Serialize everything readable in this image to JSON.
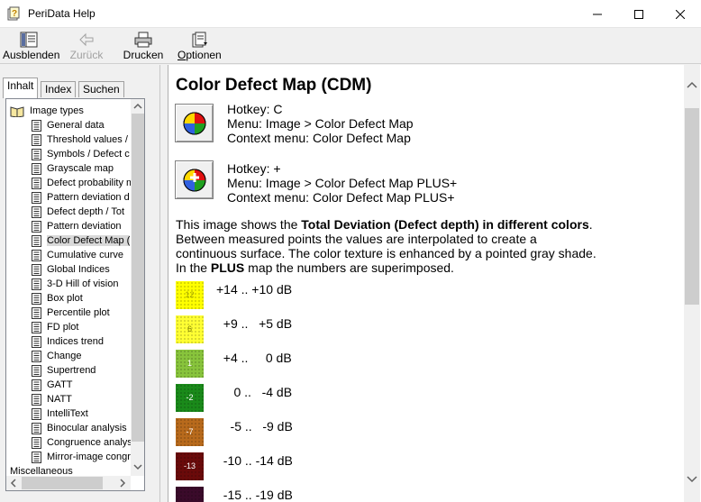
{
  "window": {
    "title": "PeriData Help"
  },
  "toolbar": {
    "hide": "Ausblenden",
    "back": "Zurück",
    "print": "Drucken",
    "options": "Optionen"
  },
  "tabs": [
    {
      "label": "Inhalt"
    },
    {
      "label": "Index"
    },
    {
      "label": "Suchen"
    }
  ],
  "tree": {
    "root": "Image types",
    "items": [
      "General data",
      "Threshold values / ",
      "Symbols / Defect c",
      "Grayscale map",
      "Defect probability m",
      "Pattern deviation d",
      "Defect depth / Tot",
      "Pattern deviation",
      "Color Defect Map (",
      "Cumulative curve",
      "Global Indices",
      "3-D Hill of vision",
      "Box plot",
      "Percentile plot",
      "FD plot",
      "Indices trend",
      "Change",
      "Supertrend",
      "GATT",
      "NATT",
      "IntelliText",
      "Binocular analysis",
      "Congruence analys",
      "Mirror-image congr"
    ],
    "selected_index": 8,
    "next_root": "Miscellaneous"
  },
  "content": {
    "title": "Color Defect Map (CDM)",
    "cdm": {
      "hotkey": "Hotkey: C",
      "menu": "Menu: Image > Color Defect Map",
      "context": "Context menu: Color Defect Map"
    },
    "cdm_plus": {
      "hotkey": "Hotkey: +",
      "menu": "Menu: Image > Color Defect Map PLUS+",
      "context": "Context menu: Color Defect Map PLUS+"
    },
    "desc": {
      "p1": "This image shows the ",
      "b1": "Total Deviation (Defect depth) in different colors",
      "p2": ". Between measured points the values are interpolated to create a continuous surface. The color texture is enhanced by a pointed gray shade. In the ",
      "b2": "PLUS",
      "p3": " map the numbers are superimposed."
    },
    "legend": [
      {
        "label": "12",
        "range": "+14 .. +10 dB",
        "color": "#ffff00",
        "text_color": "#a0a000"
      },
      {
        "label": "6",
        "range": "  +9 ..   +5 dB",
        "color": "#ffff33",
        "text_color": "#7a7a00"
      },
      {
        "label": "1",
        "range": "  +4 ..     0 dB",
        "color": "#88c43c",
        "text_color": "#ffffff"
      },
      {
        "label": "-2",
        "range": "     0 ..   -4 dB",
        "color": "#1a8a1a",
        "text_color": "#ffffff"
      },
      {
        "label": "-7",
        "range": "    -5 ..   -9 dB",
        "color": "#b86a1c",
        "text_color": "#ffffff"
      },
      {
        "label": "-13",
        "range": "  -10 .. -14 dB",
        "color": "#6a0a0a",
        "text_color": "#ffffff"
      },
      {
        "label": "",
        "range": "  -15 .. -19 dB",
        "color": "#3a0a2a",
        "text_color": "#ffffff"
      }
    ]
  }
}
